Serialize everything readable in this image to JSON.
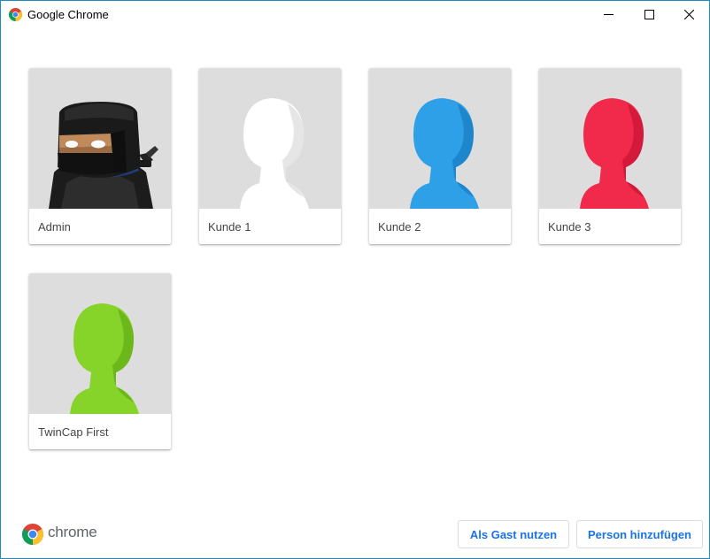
{
  "window": {
    "title": "Google Chrome",
    "accent_border": "#1b8bc8"
  },
  "titlebar": {
    "icons": [
      "chrome-logo-icon",
      "minimize-icon",
      "maximize-icon",
      "close-icon"
    ]
  },
  "profiles": [
    {
      "name": "Admin",
      "avatar": "ninja-avatar"
    },
    {
      "name": "Kunde 1",
      "avatar": "white-silhouette-avatar",
      "color": "#ffffff"
    },
    {
      "name": "Kunde 2",
      "avatar": "blue-silhouette-avatar",
      "color": "#2ea0e8"
    },
    {
      "name": "Kunde 3",
      "avatar": "red-silhouette-avatar",
      "color": "#f1294b"
    },
    {
      "name": "TwinCap First",
      "avatar": "green-silhouette-avatar",
      "color": "#86d42a"
    }
  ],
  "footer": {
    "brand": "chrome",
    "guest_button": "Als Gast nutzen",
    "add_button": "Person hinzufügen",
    "button_text_color": "#1a73e8"
  }
}
